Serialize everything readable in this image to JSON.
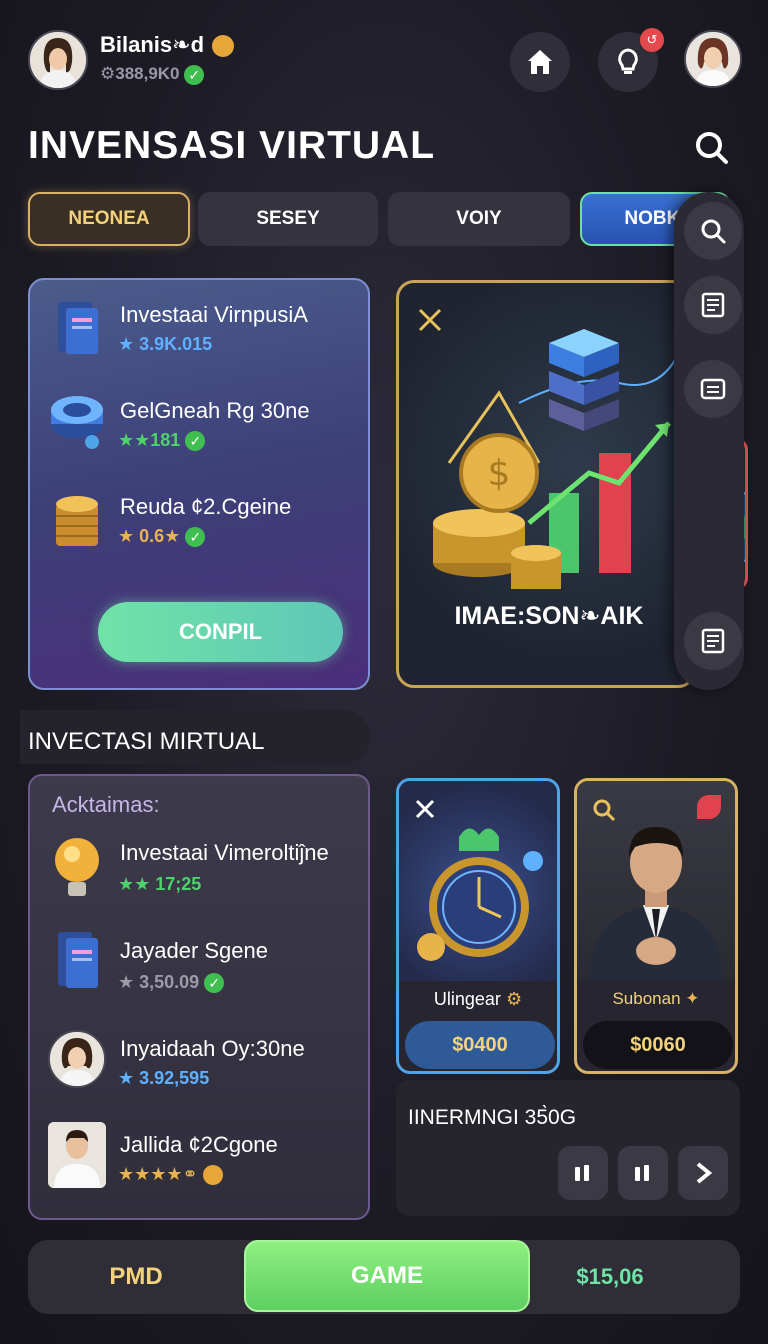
{
  "header": {
    "user_name": "Bilanis❧d",
    "balance": "⚙388,9K0",
    "home_label": "home",
    "notification_badge": "↺"
  },
  "page_title": "INVENSASI VIRTUAL",
  "tabs": [
    {
      "label": "NEONEA",
      "state": "active"
    },
    {
      "label": "SESEY",
      "state": "normal"
    },
    {
      "label": "VOIY",
      "state": "normal"
    },
    {
      "label": "NOBKI",
      "state": "highlight"
    }
  ],
  "feature_card": {
    "items": [
      {
        "title": "Investaai VirnpusiA",
        "sub": "★ 3.9K.015",
        "sub_color": "#5fb1ff",
        "icon": "book-icon"
      },
      {
        "title": "GelGneah Rg 30ne",
        "sub": "★★181",
        "sub_color": "#4cd36a",
        "icon": "disc-icon"
      },
      {
        "title": "Reuda ¢2.Cgeine",
        "sub": "★ 0.6★",
        "sub_color": "#e7b451",
        "icon": "coins-icon"
      }
    ],
    "button_label": "CONPIL"
  },
  "hero_card": {
    "caption": "IMAE:SON❧AIK"
  },
  "section_title": "INVECTASI MIRTUAL",
  "activity_list": {
    "label": "Acktaimas:",
    "items": [
      {
        "title": "Investaai Vimeroltiĵne",
        "sub": "★★ 17;25",
        "sub_color": "#4cd36a",
        "icon": "bulb-icon"
      },
      {
        "title": "Jayader Sgene",
        "sub": "★ 3,50.09",
        "sub_color": "#9d9aa8",
        "icon": "book-icon"
      },
      {
        "title": "Inyaidaah Oy:30ne",
        "sub": "★ 3.92,595",
        "sub_color": "#5fb1ff",
        "icon": "woman-avatar"
      },
      {
        "title": "Jallida ¢2Cgone",
        "sub": "★★★★⚭",
        "sub_color": "#e7b451",
        "icon": "doctor-avatar"
      }
    ]
  },
  "products": [
    {
      "name": "Ulingear",
      "price": "$0400",
      "theme": "blue"
    },
    {
      "name": "Subonan",
      "price": "$0060",
      "theme": "gold"
    }
  ],
  "panel": {
    "title": "IINERMNGI 35̀0G"
  },
  "bottom_bar": {
    "left_label": "PMD",
    "center_label": "GAME",
    "right_label": "$15,06"
  },
  "colors": {
    "accent_gold": "#d8b06a",
    "accent_green": "#6fe3a7",
    "accent_blue": "#4fa3e8"
  }
}
